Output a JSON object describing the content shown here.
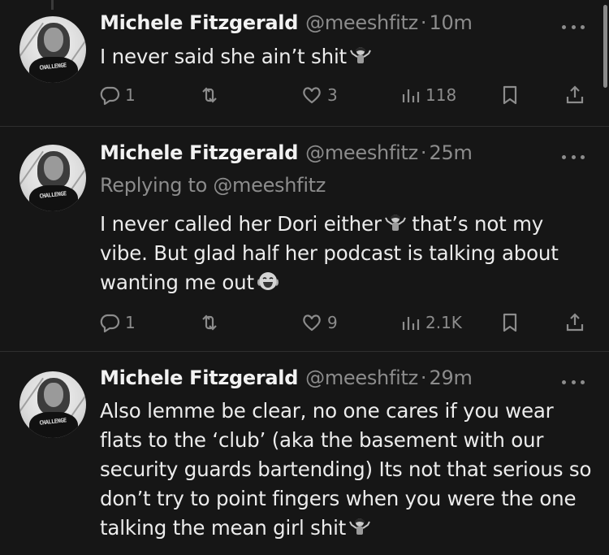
{
  "tweets": [
    {
      "name": "Michele Fitzgerald",
      "handle": "@meeshfitz",
      "separator": "·",
      "time": "10m",
      "avatar_text": "CHALLENGE",
      "text": "I never said she ain’t shit",
      "emoji": "person-shrugging-emoji",
      "replies": "1",
      "reposts": "",
      "likes": "3",
      "views": "118"
    },
    {
      "name": "Michele Fitzgerald",
      "handle": "@meeshfitz",
      "separator": "·",
      "time": "25m",
      "avatar_text": "CHALLENGE",
      "replying_to_prefix": "Replying to ",
      "replying_to_handle": "@meeshfitz",
      "text_part1": "I never called her Dori either",
      "text_part2": " that’s not my vibe. But glad half her podcast is talking about wanting me out",
      "emoji1": "person-shrugging-emoji",
      "emoji2": "laughing-crying-emoji",
      "replies": "1",
      "reposts": "",
      "likes": "9",
      "views": "2.1K"
    },
    {
      "name": "Michele Fitzgerald",
      "handle": "@meeshfitz",
      "separator": "·",
      "time": "29m",
      "avatar_text": "CHALLENGE",
      "text": "Also lemme be clear, no one cares if you wear flats to the ‘club’ (aka the basement with our security guards bartending) Its not that serious so don’t try to point fingers when you were the one talking the mean girl shit",
      "emoji": "person-shrugging-emoji"
    }
  ],
  "colors": {
    "background": "#161616",
    "text": "#ececec",
    "muted": "#8c8c8c",
    "divider": "#2f2f2f"
  },
  "icons": [
    "reply-icon",
    "repost-icon",
    "like-icon",
    "views-icon",
    "bookmark-icon",
    "share-icon",
    "more-icon"
  ]
}
